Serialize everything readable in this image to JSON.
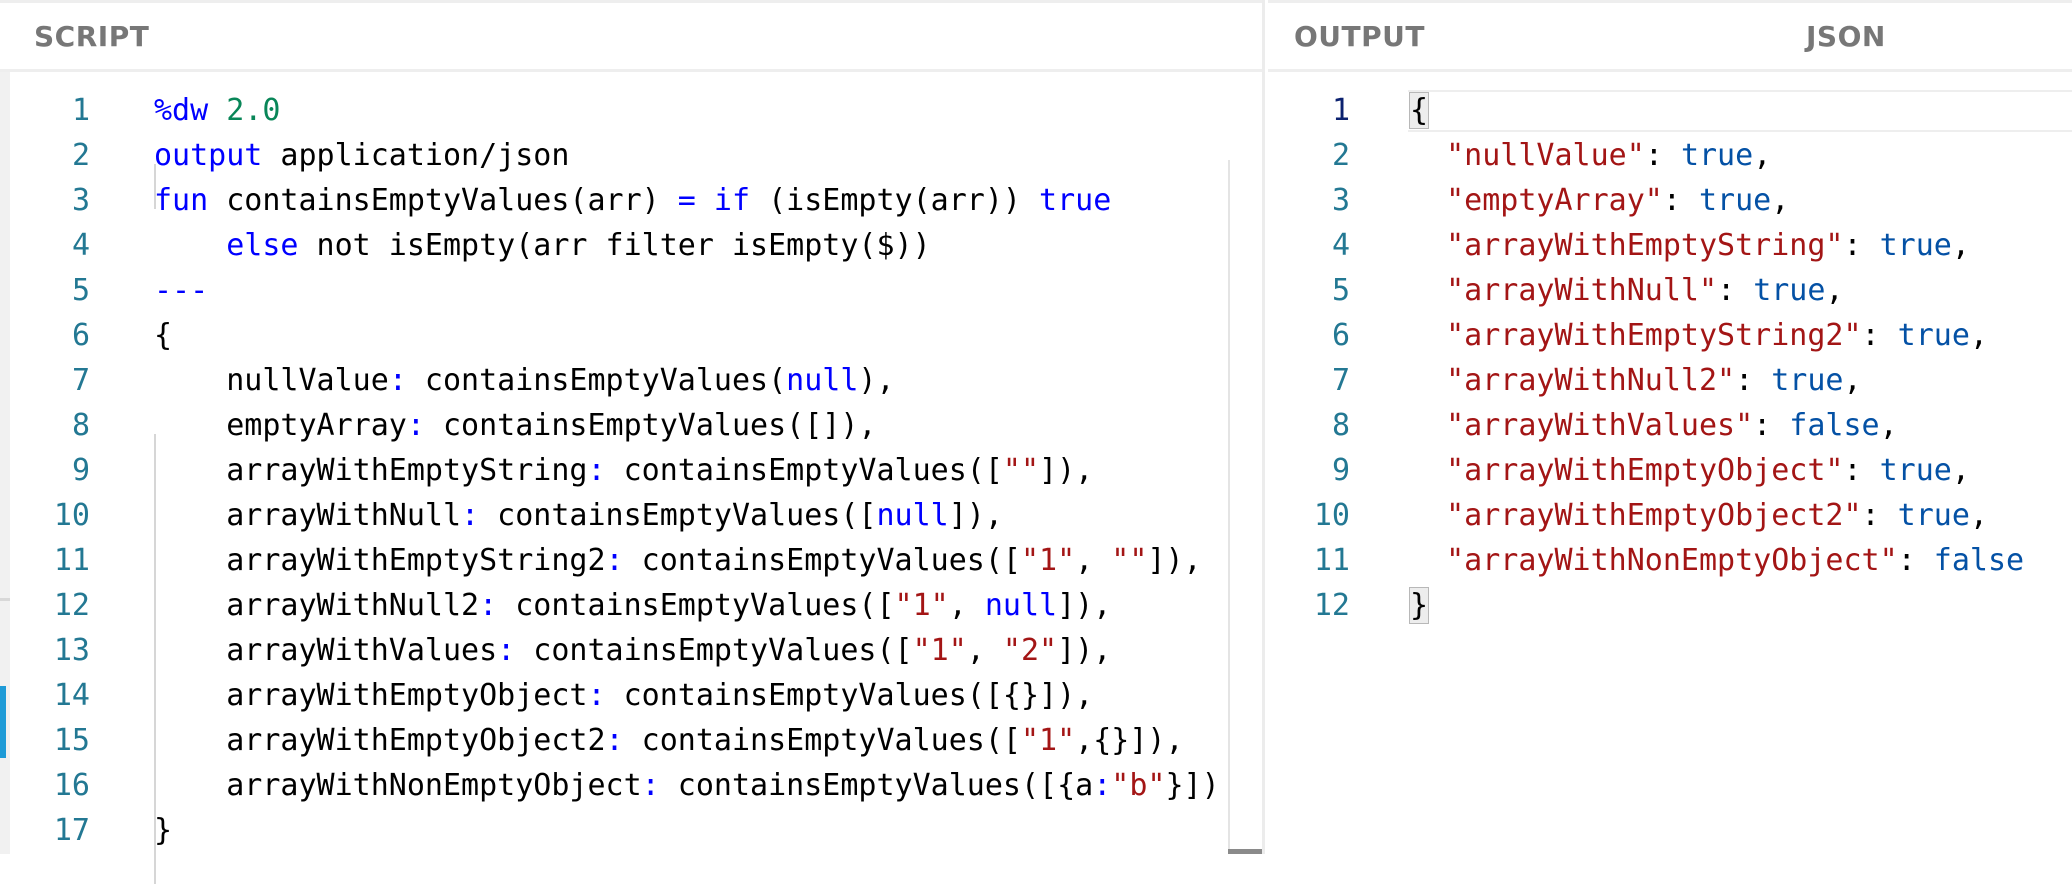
{
  "script_pane": {
    "title": "SCRIPT",
    "lines": [
      {
        "n": "1",
        "parts": [
          [
            "kwb",
            "%dw"
          ],
          [
            "",
            ""
          ],
          [
            "num",
            " 2.0"
          ]
        ]
      },
      {
        "n": "2",
        "parts": [
          [
            "kwb",
            "output"
          ],
          [
            "",
            " application/json"
          ]
        ]
      },
      {
        "n": "3",
        "parts": [
          [
            "kwb",
            "fun"
          ],
          [
            "",
            " containsEmptyValues(arr) "
          ],
          [
            "kwb",
            "="
          ],
          [
            "",
            ""
          ],
          [
            "kwb",
            " if"
          ],
          [
            "",
            " (isEmpty(arr)) "
          ],
          [
            "kwb",
            "true"
          ]
        ]
      },
      {
        "n": "4",
        "parts": [
          [
            "",
            "    "
          ],
          [
            "kwb",
            "else"
          ],
          [
            "",
            " not isEmpty(arr filter isEmpty($))"
          ]
        ]
      },
      {
        "n": "5",
        "parts": [
          [
            "kwb",
            "---"
          ]
        ]
      },
      {
        "n": "6",
        "parts": [
          [
            "",
            "{"
          ]
        ]
      },
      {
        "n": "7",
        "parts": [
          [
            "",
            "    nullValue"
          ],
          [
            "kwb",
            ":"
          ],
          [
            "",
            " containsEmptyValues("
          ],
          [
            "kwb",
            "null"
          ],
          [
            "",
            "),"
          ]
        ]
      },
      {
        "n": "8",
        "parts": [
          [
            "",
            "    emptyArray"
          ],
          [
            "kwb",
            ":"
          ],
          [
            "",
            " containsEmptyValues([]),"
          ]
        ]
      },
      {
        "n": "9",
        "parts": [
          [
            "",
            "    arrayWithEmptyString"
          ],
          [
            "kwb",
            ":"
          ],
          [
            "",
            " containsEmptyValues(["
          ],
          [
            "str",
            "\"\""
          ],
          [
            "",
            "]),"
          ]
        ]
      },
      {
        "n": "10",
        "parts": [
          [
            "",
            "    arrayWithNull"
          ],
          [
            "kwb",
            ":"
          ],
          [
            "",
            " containsEmptyValues(["
          ],
          [
            "kwb",
            "null"
          ],
          [
            "",
            "]),"
          ]
        ]
      },
      {
        "n": "11",
        "parts": [
          [
            "",
            "    arrayWithEmptyString2"
          ],
          [
            "kwb",
            ":"
          ],
          [
            "",
            " containsEmptyValues(["
          ],
          [
            "str",
            "\"1\""
          ],
          [
            "",
            ", "
          ],
          [
            "str",
            "\"\""
          ],
          [
            "",
            "]),"
          ]
        ]
      },
      {
        "n": "12",
        "parts": [
          [
            "",
            "    arrayWithNull2"
          ],
          [
            "kwb",
            ":"
          ],
          [
            "",
            " containsEmptyValues(["
          ],
          [
            "str",
            "\"1\""
          ],
          [
            "",
            ", "
          ],
          [
            "kwb",
            "null"
          ],
          [
            "",
            "]),"
          ]
        ]
      },
      {
        "n": "13",
        "parts": [
          [
            "",
            "    arrayWithValues"
          ],
          [
            "kwb",
            ":"
          ],
          [
            "",
            " containsEmptyValues(["
          ],
          [
            "str",
            "\"1\""
          ],
          [
            "",
            ", "
          ],
          [
            "str",
            "\"2\""
          ],
          [
            "",
            "]),"
          ]
        ]
      },
      {
        "n": "14",
        "parts": [
          [
            "",
            "    arrayWithEmptyObject"
          ],
          [
            "kwb",
            ":"
          ],
          [
            "",
            " containsEmptyValues([{}]),"
          ]
        ]
      },
      {
        "n": "15",
        "parts": [
          [
            "",
            "    arrayWithEmptyObject2"
          ],
          [
            "kwb",
            ":"
          ],
          [
            "",
            " containsEmptyValues(["
          ],
          [
            "str",
            "\"1\""
          ],
          [
            "",
            ",{}]),"
          ]
        ]
      },
      {
        "n": "16",
        "parts": [
          [
            "",
            "    arrayWithNonEmptyObject"
          ],
          [
            "kwb",
            ":"
          ],
          [
            "",
            " containsEmptyValues([{a"
          ],
          [
            "kwb",
            ":"
          ],
          [
            "str",
            "\"b\""
          ],
          [
            "",
            "}])"
          ]
        ]
      },
      {
        "n": "17",
        "parts": [
          [
            "",
            "}"
          ]
        ]
      }
    ]
  },
  "output_pane": {
    "title": "OUTPUT",
    "format": "JSON",
    "lines": [
      {
        "n": "1",
        "parts": [
          [
            "brace",
            "{"
          ]
        ]
      },
      {
        "n": "2",
        "parts": [
          [
            "",
            "  "
          ],
          [
            "key",
            "\"nullValue\""
          ],
          [
            "",
            ": "
          ],
          [
            "bool",
            "true"
          ],
          [
            "",
            ","
          ]
        ]
      },
      {
        "n": "3",
        "parts": [
          [
            "",
            "  "
          ],
          [
            "key",
            "\"emptyArray\""
          ],
          [
            "",
            ": "
          ],
          [
            "bool",
            "true"
          ],
          [
            "",
            ","
          ]
        ]
      },
      {
        "n": "4",
        "parts": [
          [
            "",
            "  "
          ],
          [
            "key",
            "\"arrayWithEmptyString\""
          ],
          [
            "",
            ": "
          ],
          [
            "bool",
            "true"
          ],
          [
            "",
            ","
          ]
        ]
      },
      {
        "n": "5",
        "parts": [
          [
            "",
            "  "
          ],
          [
            "key",
            "\"arrayWithNull\""
          ],
          [
            "",
            ": "
          ],
          [
            "bool",
            "true"
          ],
          [
            "",
            ","
          ]
        ]
      },
      {
        "n": "6",
        "parts": [
          [
            "",
            "  "
          ],
          [
            "key",
            "\"arrayWithEmptyString2\""
          ],
          [
            "",
            ": "
          ],
          [
            "bool",
            "true"
          ],
          [
            "",
            ","
          ]
        ]
      },
      {
        "n": "7",
        "parts": [
          [
            "",
            "  "
          ],
          [
            "key",
            "\"arrayWithNull2\""
          ],
          [
            "",
            ": "
          ],
          [
            "bool",
            "true"
          ],
          [
            "",
            ","
          ]
        ]
      },
      {
        "n": "8",
        "parts": [
          [
            "",
            "  "
          ],
          [
            "key",
            "\"arrayWithValues\""
          ],
          [
            "",
            ": "
          ],
          [
            "bool",
            "false"
          ],
          [
            "",
            ","
          ]
        ]
      },
      {
        "n": "9",
        "parts": [
          [
            "",
            "  "
          ],
          [
            "key",
            "\"arrayWithEmptyObject\""
          ],
          [
            "",
            ": "
          ],
          [
            "bool",
            "true"
          ],
          [
            "",
            ","
          ]
        ]
      },
      {
        "n": "10",
        "parts": [
          [
            "",
            "  "
          ],
          [
            "key",
            "\"arrayWithEmptyObject2\""
          ],
          [
            "",
            ": "
          ],
          [
            "bool",
            "true"
          ],
          [
            "",
            ","
          ]
        ]
      },
      {
        "n": "11",
        "parts": [
          [
            "",
            "  "
          ],
          [
            "key",
            "\"arrayWithNonEmptyObject\""
          ],
          [
            "",
            ": "
          ],
          [
            "bool",
            "false"
          ]
        ]
      },
      {
        "n": "12",
        "parts": [
          [
            "brace",
            "}"
          ]
        ]
      }
    ]
  }
}
